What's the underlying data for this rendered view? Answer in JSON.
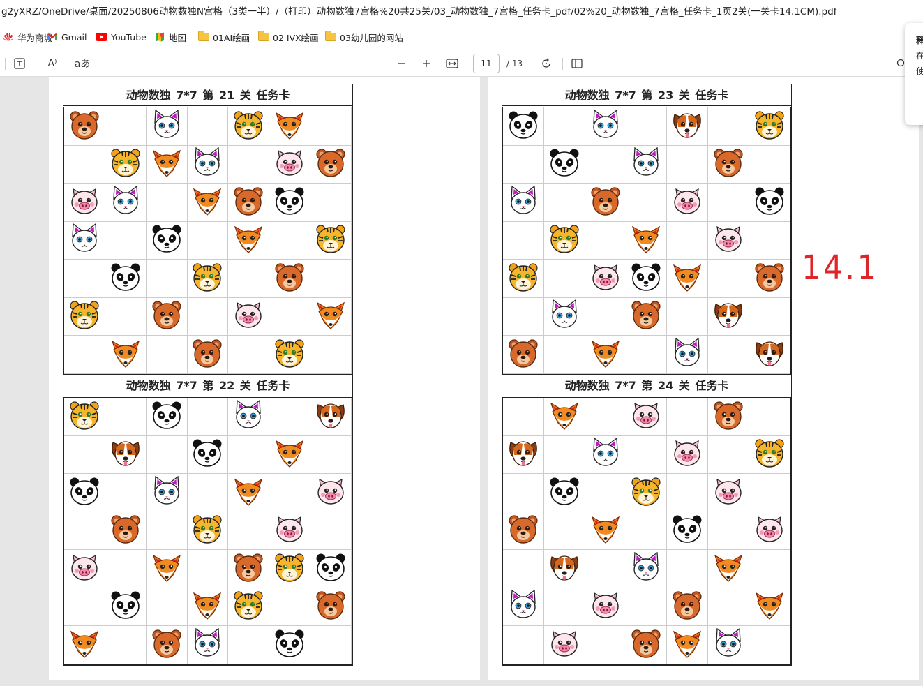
{
  "address": "g2yXRZ/OneDrive/桌面/20250806动物数独N宫格（3类一半）/（打印）动物数独7宫格%20共25关/03_动物数独_7宫格_任务卡_pdf/02%20_动物数独_7宫格_任务卡_1页2关(一关卡14.1CM).pdf",
  "bookmarks": [
    {
      "label": "华为商城",
      "icon": "huawei-icon"
    },
    {
      "label": "Gmail",
      "icon": "gmail-icon"
    },
    {
      "label": "YouTube",
      "icon": "youtube-icon"
    },
    {
      "label": "地图",
      "icon": "maps-icon"
    },
    {
      "label": "01AI绘画",
      "icon": "folder-icon"
    },
    {
      "label": "02 IVX绘画",
      "icon": "folder-icon"
    },
    {
      "label": "03幼儿园的网站",
      "icon": "folder-icon"
    }
  ],
  "toolbar": {
    "current_page": "11",
    "total_pages": "/ 13",
    "read_aloud_glyph": "A⁾",
    "translate_glyph": "aあ",
    "text_glyph": "T"
  },
  "cards": [
    {
      "title": "动物数独 7*7   第 21 关 任务卡",
      "level": 21,
      "grid": [
        "bear",
        "",
        "cat",
        "",
        "tiger",
        "fox",
        "",
        "",
        "tiger",
        "fox",
        "cat",
        "",
        "pig",
        "bear",
        "pig",
        "cat",
        "",
        "fox",
        "bear",
        "panda",
        "",
        "cat",
        "",
        "panda",
        "",
        "fox",
        "",
        "tiger",
        "",
        "panda",
        "",
        "tiger",
        "",
        "bear",
        "",
        "tiger",
        "",
        "bear",
        "",
        "pig",
        "",
        "fox",
        "",
        "fox",
        "",
        "bear",
        "",
        "tiger",
        ""
      ]
    },
    {
      "title": "动物数独 7*7   第 22 关 任务卡",
      "level": 22,
      "grid": [
        "tiger",
        "",
        "panda",
        "",
        "cat",
        "",
        "dog",
        "",
        "dog",
        "",
        "panda",
        "",
        "fox",
        "",
        "panda",
        "",
        "cat",
        "",
        "fox",
        "",
        "pig",
        "",
        "bear",
        "",
        "tiger",
        "",
        "pig",
        "",
        "pig",
        "",
        "fox",
        "",
        "bear",
        "tiger",
        "panda",
        "",
        "panda",
        "",
        "fox",
        "tiger",
        "",
        "bear",
        "fox",
        "",
        "bear",
        "cat",
        "",
        "panda",
        ""
      ]
    },
    {
      "title": "动物数独 7*7   第 23 关 任务卡",
      "level": 23,
      "grid": [
        "panda",
        "",
        "cat",
        "",
        "dog",
        "",
        "tiger",
        "",
        "panda",
        "",
        "cat",
        "",
        "bear",
        "",
        "cat",
        "",
        "bear",
        "",
        "pig",
        "",
        "panda",
        "",
        "tiger",
        "",
        "fox",
        "",
        "pig",
        "",
        "tiger",
        "",
        "pig",
        "panda",
        "fox",
        "",
        "bear",
        "",
        "cat",
        "",
        "bear",
        "",
        "dog",
        "",
        "bear",
        "",
        "fox",
        "",
        "cat",
        "",
        "dog"
      ]
    },
    {
      "title": "动物数独 7*7   第 24 关 任务卡",
      "level": 24,
      "grid": [
        "",
        "fox",
        "",
        "pig",
        "",
        "bear",
        "",
        "dog",
        "",
        "cat",
        "",
        "pig",
        "",
        "tiger",
        "",
        "panda",
        "",
        "tiger",
        "",
        "pig",
        "",
        "bear",
        "",
        "fox",
        "",
        "panda",
        "",
        "pig",
        "",
        "dog",
        "",
        "cat",
        "",
        "fox",
        "",
        "cat",
        "",
        "pig",
        "",
        "bear",
        "",
        "fox",
        "",
        "pig",
        "",
        "bear",
        "fox",
        "cat",
        ""
      ]
    }
  ],
  "handwritten_note": "14.1",
  "side_panel": {
    "line1": "释",
    "line2": "在",
    "line3": "使"
  },
  "colors": {
    "note_red": "#e0252a"
  }
}
